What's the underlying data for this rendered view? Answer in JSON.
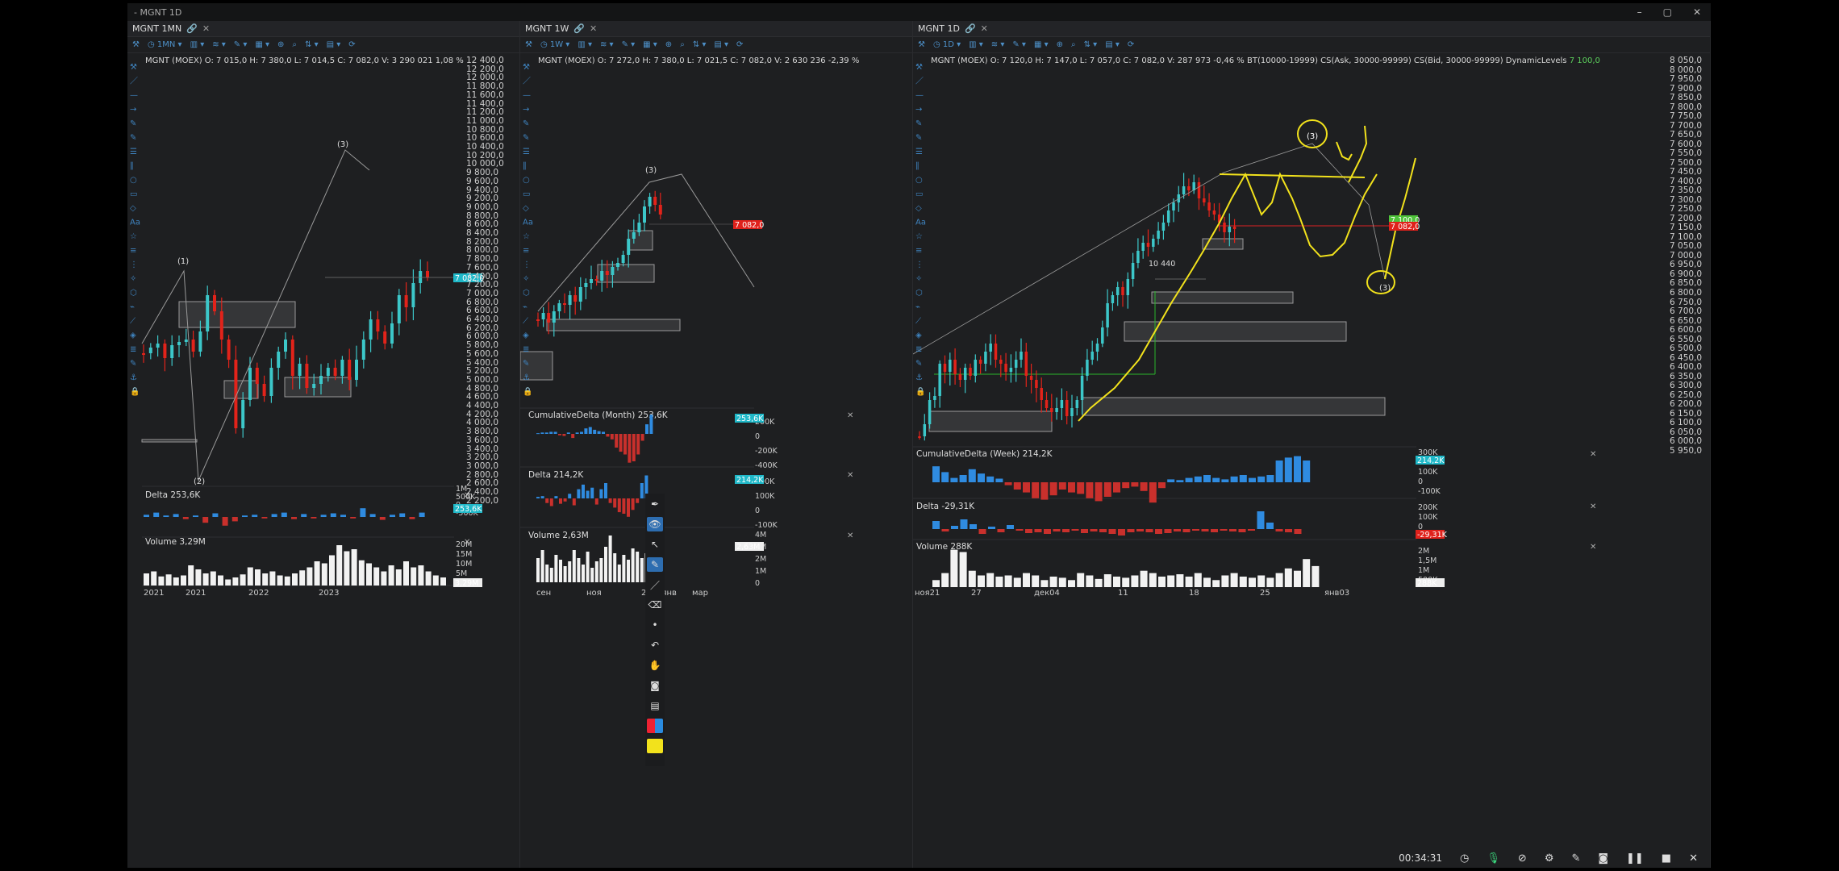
{
  "window": {
    "title": "- MGNT 1D"
  },
  "panels": [
    {
      "id": "p1",
      "tab": "MGNT 1MN",
      "timeframe": "1MN",
      "info": "MGNT (MOEX) O: 7 015,0  H: 7 380,0  L: 7 014,5  C: 7 082,0  V: 3 290 021  1,08 %",
      "price_labels": [
        "12 400,0",
        "12 200,0",
        "12 000,0",
        "11 800,0",
        "11 600,0",
        "11 400,0",
        "11 200,0",
        "11 000,0",
        "10 800,0",
        "10 600,0",
        "10 400,0",
        "10 200,0",
        "10 000,0",
        "9 800,0",
        "9 600,0",
        "9 400,0",
        "9 200,0",
        "9 000,0",
        "8 800,0",
        "8 600,0",
        "8 400,0",
        "8 200,0",
        "8 000,0",
        "7 800,0",
        "7 600,0",
        "7 400,0",
        "7 200,0",
        "7 000,0",
        "6 800,0",
        "6 600,0",
        "6 400,0",
        "6 200,0",
        "6 000,0",
        "5 800,0",
        "5 600,0",
        "5 400,0",
        "5 200,0",
        "5 000,0",
        "4 800,0",
        "4 600,0",
        "4 400,0",
        "4 200,0",
        "4 000,0",
        "3 800,0",
        "3 600,0",
        "3 400,0",
        "3 200,0",
        "3 000,0",
        "2 800,0",
        "2 600,0",
        "2 400,0",
        "2 200,0"
      ],
      "price_badge": "7 082,0",
      "wave_labels": [
        "(1)",
        "(2)",
        "(3)"
      ],
      "sub": [
        {
          "title": "Delta 253,6K",
          "axis": [
            "1M",
            "500K",
            "0",
            "-500K"
          ],
          "badge": "253,6K"
        },
        {
          "title": "Volume 3,29M",
          "axis": [
            "20M",
            "15M",
            "10M",
            "5M"
          ],
          "badge": "3,29M"
        }
      ],
      "x_labels": [
        "2021",
        "2021",
        "2022",
        "2023"
      ]
    },
    {
      "id": "p2",
      "tab": "MGNT 1W",
      "timeframe": "1W",
      "info": "MGNT (MOEX) O: 7 272,0  H: 7 380,0  L: 7 021,5  C: 7 082,0  V: 2 630 236  -2,39 %",
      "price_labels": [
        "9 800,0",
        "9 600,0",
        "9 400,0",
        "9 200,0",
        "9 000,0",
        "8 800,0",
        "8 600,0",
        "8 400,0",
        "8 200,0",
        "8 000,0",
        "7 800,0",
        "7 600,0",
        "7 400,0",
        "7 200,0",
        "7 000,0",
        "6 800,0",
        "6 600,0",
        "6 400,0",
        "6 200,0",
        "6 000,0",
        "5 800,0",
        "5 600,0",
        "5 400,0",
        "5 200,0",
        "5 000,0",
        "4 800,0",
        "4 600,0",
        "4 400,0"
      ],
      "price_badge": "7 082,0",
      "wave_labels": [
        "(3)"
      ],
      "sub": [
        {
          "title": "CumulativeDelta (Month) 253,6K",
          "axis": [
            "200K",
            "0",
            "-200K",
            "-400K"
          ],
          "badge": "253,6K"
        },
        {
          "title": "Delta 214,2K",
          "axis": [
            "200K",
            "100K",
            "0",
            "-100K"
          ],
          "badge": "214,2K"
        },
        {
          "title": "Volume 2,63M",
          "axis": [
            "4M",
            "3M",
            "2M",
            "1M",
            "0"
          ],
          "badge": "2,63M"
        }
      ],
      "x_labels": [
        "сен",
        "ноя",
        "2024янв",
        "мар"
      ]
    },
    {
      "id": "p3",
      "tab": "MGNT 1D",
      "timeframe": "1D",
      "info": "MGNT (MOEX) O: 7 120,0  H: 7 147,0  L: 7 057,0  C: 7 082,0  V: 287 973  -0,46 %  BT(10000-19999)  CS(Ask, 30000-99999)  CS(Bid, 30000-99999)  DynamicLevels",
      "info_green": "7 100,0",
      "price_labels": [
        "8 050,0",
        "8 000,0",
        "7 950,0",
        "7 900,0",
        "7 850,0",
        "7 800,0",
        "7 750,0",
        "7 700,0",
        "7 650,0",
        "7 600,0",
        "7 550,0",
        "7 500,0",
        "7 450,0",
        "7 400,0",
        "7 350,0",
        "7 300,0",
        "7 250,0",
        "7 200,0",
        "7 150,0",
        "7 100,0",
        "7 050,0",
        "7 000,0",
        "6 950,0",
        "6 900,0",
        "6 850,0",
        "6 800,0",
        "6 750,0",
        "6 700,0",
        "6 650,0",
        "6 600,0",
        "6 550,0",
        "6 500,0",
        "6 450,0",
        "6 400,0",
        "6 350,0",
        "6 300,0",
        "6 250,0",
        "6 200,0",
        "6 150,0",
        "6 100,0",
        "6 050,0",
        "6 000,0",
        "5 950,0"
      ],
      "price_badge": "7 100,0",
      "price_badge2": "7 082,0",
      "wave_labels": [
        "(3)",
        "(3)"
      ],
      "level_label": "10 440",
      "sub": [
        {
          "title": "CumulativeDelta (Week) 214,2K",
          "axis": [
            "300K",
            "200K",
            "100K",
            "0",
            "-100K"
          ],
          "badge": "214,2K"
        },
        {
          "title": "Delta -29,31K",
          "axis": [
            "200K",
            "100K",
            "0"
          ],
          "badge": "-29,31K"
        },
        {
          "title": "Volume 288K",
          "axis": [
            "2M",
            "1,5M",
            "1M",
            "500K"
          ],
          "badge": "288K"
        }
      ],
      "x_labels": [
        "ноя21",
        "27",
        "дек04",
        "11",
        "18",
        "25",
        "янв03"
      ]
    }
  ],
  "recorder": {
    "timer": "00:34:31"
  },
  "colors": {
    "bull": "#3cc7c9",
    "bear": "#e2231a",
    "delta_pos": "#2f8be0",
    "delta_neg": "#c9302c",
    "badge_cyan": "#1fb8c8",
    "badge_red": "#e0211b",
    "annotation": "#f2e21c",
    "badge_green": "#4fc23a"
  }
}
